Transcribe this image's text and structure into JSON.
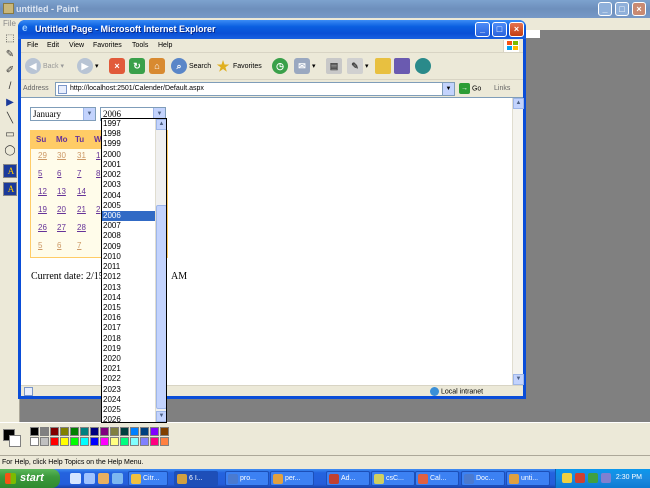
{
  "paint": {
    "title": "untitled - Paint",
    "menu_first": "File",
    "status": "For Help, click Help Topics on the Help Menu.",
    "palette": [
      "#000000",
      "#808080",
      "#800000",
      "#808000",
      "#008000",
      "#008080",
      "#000080",
      "#800080",
      "#808040",
      "#004040",
      "#0080ff",
      "#004080",
      "#8000ff",
      "#804000",
      "#ffffff",
      "#c0c0c0",
      "#ff0000",
      "#ffff00",
      "#00ff00",
      "#00ffff",
      "#0000ff",
      "#ff00ff",
      "#ffff80",
      "#00ff80",
      "#80ffff",
      "#8080ff",
      "#ff0080",
      "#ff8040"
    ]
  },
  "ie": {
    "title": "Untitled Page - Microsoft Internet Explorer",
    "menu": [
      "File",
      "Edit",
      "View",
      "Favorites",
      "Tools",
      "Help"
    ],
    "toolbar": {
      "back": "Back",
      "search": "Search",
      "favorites": "Favorites"
    },
    "address_label": "Address",
    "address_url": "http://localhost:2501/Calender/Default.aspx",
    "go_label": "Go",
    "links_label": "Links",
    "status_zone": "Local intranet"
  },
  "page": {
    "month_selected": "January",
    "year_selected": "2006",
    "calendar": {
      "day_headers": [
        "Su",
        "Mo",
        "Tu",
        "W"
      ],
      "rows": [
        [
          "29",
          "30",
          "31",
          "1"
        ],
        [
          "5",
          "6",
          "7",
          "8"
        ],
        [
          "12",
          "13",
          "14",
          ""
        ],
        [
          "19",
          "20",
          "21",
          "2"
        ],
        [
          "26",
          "27",
          "28",
          ""
        ],
        [
          "5",
          "6",
          "7",
          ""
        ]
      ]
    },
    "current_date_label": "Current date: 2/15",
    "current_date_tail": "AM",
    "year_options": [
      "1997",
      "1998",
      "1999",
      "2000",
      "2001",
      "2002",
      "2003",
      "2004",
      "2005",
      "2006",
      "2007",
      "2008",
      "2009",
      "2010",
      "2011",
      "2012",
      "2013",
      "2014",
      "2015",
      "2016",
      "2017",
      "2018",
      "2019",
      "2020",
      "2021",
      "2022",
      "2023",
      "2024",
      "2025",
      "2026"
    ]
  },
  "taskbar": {
    "start_label": "start",
    "tasks": [
      "",
      "6 I...",
      "Citr...",
      "pro...",
      "per...",
      "Ad...",
      "csC...",
      "Cal...",
      "Doc...",
      "unti..."
    ],
    "clock": "2:30 PM"
  }
}
